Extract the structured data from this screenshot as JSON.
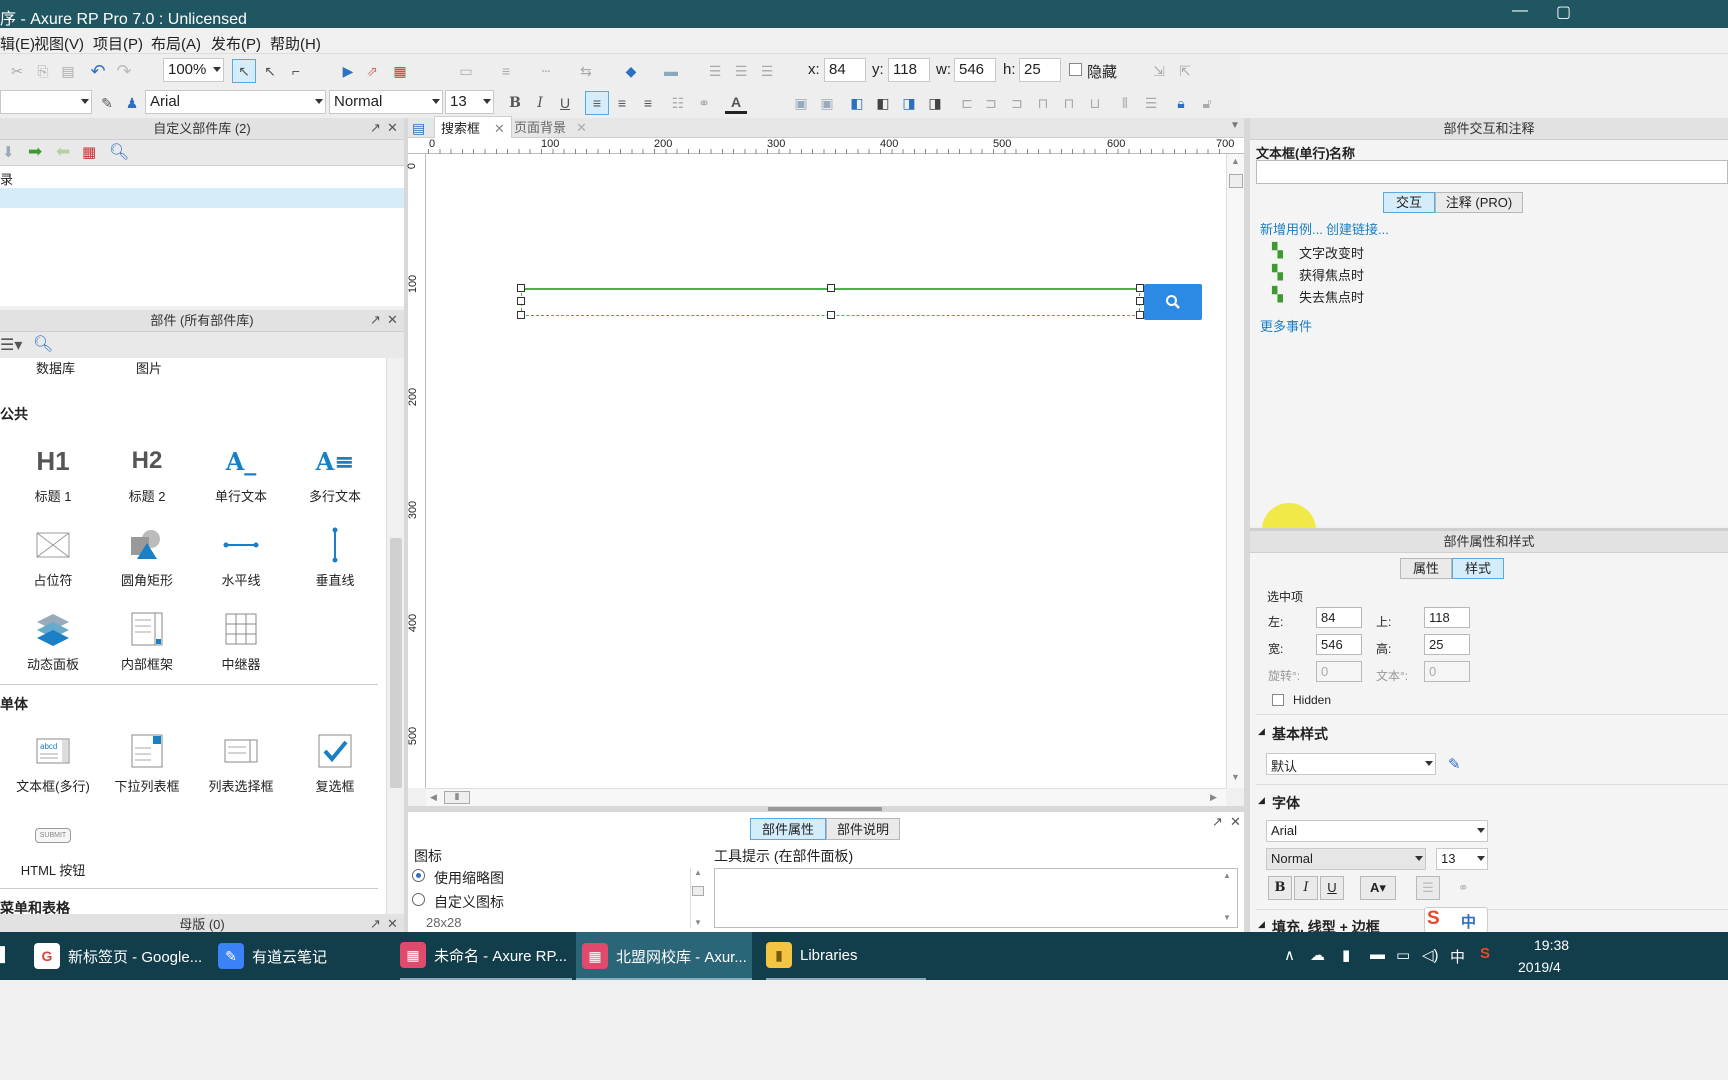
{
  "window": {
    "title": "序 - Axure RP Pro 7.0 : Unlicensed"
  },
  "menu": [
    "辑(E)",
    "视图(V)",
    "项目(P)",
    "布局(A)",
    "发布(P)",
    "帮助(H)"
  ],
  "toolbar": {
    "zoom": "100%",
    "x_label": "x:",
    "x": "84",
    "y_label": "y:",
    "y": "118",
    "w_label": "w:",
    "w": "546",
    "h_label": "h:",
    "h": "25",
    "hidden_label": "隐藏",
    "font_family": "Arial",
    "font_style": "Normal",
    "font_size": "13"
  },
  "left_top_panel": {
    "title": "自定义部件库 (2)",
    "tree_root": "录"
  },
  "widgets_panel": {
    "title": "部件 (所有部件库)",
    "top_row": [
      "数据库",
      "图片"
    ],
    "section_common": "公共",
    "common": [
      {
        "icon": "H1",
        "label": "标题 1"
      },
      {
        "icon": "H2",
        "label": "标题 2"
      },
      {
        "icon": "A_",
        "label": "单行文本"
      },
      {
        "icon": "A≡",
        "label": "多行文本"
      },
      {
        "label": "占位符"
      },
      {
        "label": "圆角矩形"
      },
      {
        "label": "水平线"
      },
      {
        "label": "垂直线"
      },
      {
        "label": "动态面板"
      },
      {
        "label": "内部框架"
      },
      {
        "label": "中继器"
      }
    ],
    "section_form": "单体",
    "form": [
      {
        "icon": "abcd",
        "label": "文本框(多行)"
      },
      {
        "label": "下拉列表框"
      },
      {
        "label": "列表选择框"
      },
      {
        "label": "复选框"
      },
      {
        "icon": "SUBMIT",
        "label": "HTML 按钮"
      }
    ],
    "section_menu": "菜单和表格"
  },
  "masters_panel": {
    "title": "母版 (0)"
  },
  "canvas": {
    "tabs": [
      {
        "label": "搜索框",
        "active": true
      },
      {
        "label": "页面背景",
        "active": false
      }
    ],
    "ruler_h": [
      "0",
      "100",
      "200",
      "300",
      "400",
      "500",
      "600",
      "700"
    ],
    "ruler_v": [
      "0",
      "100",
      "200",
      "300",
      "400",
      "500"
    ]
  },
  "bottom_panel": {
    "tabs": [
      "部件属性",
      "部件说明"
    ],
    "icon_label": "图标",
    "radio_thumbnail": "使用缩略图",
    "radio_custom": "自定义图标",
    "icon_size": "28x28",
    "tooltip_label": "工具提示 (在部件面板)"
  },
  "interactions_panel": {
    "title": "部件交互和注释",
    "widget_type": "文本框(单行)",
    "name_label": "名称",
    "tab_interact": "交互",
    "tab_notes": "注释 (PRO)",
    "add_case": "新增用例...",
    "create_link": "创建链接...",
    "events": [
      "文字改变时",
      "获得焦点时",
      "失去焦点时"
    ],
    "more_events": "更多事件"
  },
  "style_panel": {
    "title": "部件属性和样式",
    "tab_props": "属性",
    "tab_style": "样式",
    "selected_label": "选中项",
    "left_label": "左:",
    "left": "84",
    "top_label": "上:",
    "top": "118",
    "width_label": "宽:",
    "width": "546",
    "height_label": "高:",
    "height": "25",
    "rotate_label": "旋转°:",
    "rotate": "0",
    "text_rotate_label": "文本°:",
    "text_rotate": "0",
    "hidden_label": "Hidden",
    "base_style_section": "基本样式",
    "base_style": "默认",
    "font_section": "字体",
    "font_family": "Arial",
    "font_style": "Normal",
    "font_size": "13",
    "fill_section": "填充, 线型 + 边框"
  },
  "ime": {
    "mode": "中"
  },
  "taskbar": {
    "items": [
      {
        "label": "新标签页 - Google...",
        "color": "#ffffff",
        "fg": "#db4437",
        "icon": "G"
      },
      {
        "label": "有道云笔记",
        "color": "#3b82f6",
        "fg": "#ffffff",
        "icon": "✎"
      },
      {
        "label": "未命名 - Axure RP...",
        "color": "#e04a6d",
        "fg": "#ffffff",
        "icon": "▦"
      },
      {
        "label": "北盟网校库 - Axur...",
        "color": "#e04a6d",
        "fg": "#ffffff",
        "icon": "▦"
      },
      {
        "label": "Libraries",
        "color": "#f4c542",
        "fg": "#7a5a00",
        "icon": "▮"
      }
    ],
    "tray_lang": "中",
    "time": "19:38",
    "date": "2019/4"
  },
  "colors": {
    "titlebar": "#1f5662",
    "taskbar": "#123d4a",
    "accent": "#2d8ae4",
    "selection": "#4caf50"
  }
}
